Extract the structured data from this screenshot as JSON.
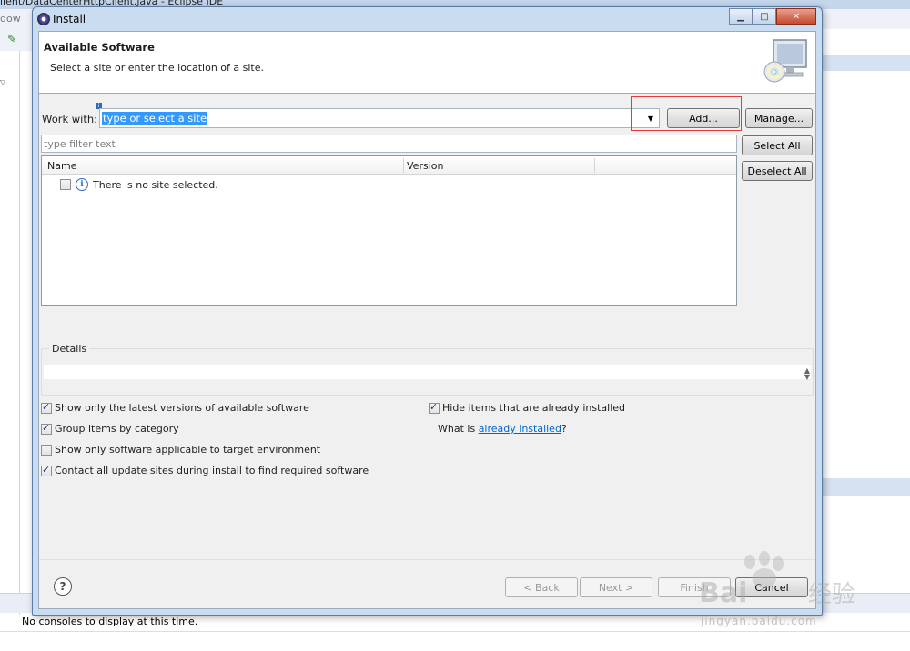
{
  "background_ide": {
    "window_title": "lient/DataCenterHttpClient.java - Eclipse IDE",
    "menu_fragment": "dow",
    "console_message": "No consoles to display at this time."
  },
  "dialog": {
    "title": "Install",
    "window_buttons": {
      "minimize": "▁",
      "maximize": "□",
      "close": "✕"
    },
    "header": {
      "title": "Available Software",
      "description": "Select a site or enter the location of a site."
    },
    "work_with": {
      "label": "Work with:",
      "value": "type or select a site"
    },
    "buttons": {
      "add": "Add...",
      "manage": "Manage...",
      "select_all": "Select All",
      "deselect_all": "Deselect All",
      "back": "< Back",
      "next": "Next >",
      "finish": "Finish",
      "cancel": "Cancel"
    },
    "filter": {
      "placeholder": "type filter text"
    },
    "table": {
      "columns": [
        "Name",
        "Version"
      ],
      "rows": [
        {
          "name": "There is no site selected.",
          "checked": false
        }
      ]
    },
    "details": {
      "label": "Details",
      "text": ""
    },
    "options": [
      {
        "label": "Show only the latest versions of available software",
        "checked": true
      },
      {
        "label": "Group items by category",
        "checked": true
      },
      {
        "label": "Show only software applicable to target environment",
        "checked": false
      },
      {
        "label": "Contact all update sites during install to find required software",
        "checked": true
      },
      {
        "label": "Hide items that are already installed",
        "checked": true
      }
    ],
    "already_installed": {
      "prefix": "What is ",
      "link": "already installed",
      "suffix": "?"
    }
  },
  "watermark": {
    "logo": "Bai 经验",
    "url": "jingyan.baidu.com"
  },
  "colors": {
    "selection": "#3399ff",
    "link": "#0066cc",
    "highlight_box": "#e63a3a",
    "dialog_frame": "#c9dcf0"
  }
}
